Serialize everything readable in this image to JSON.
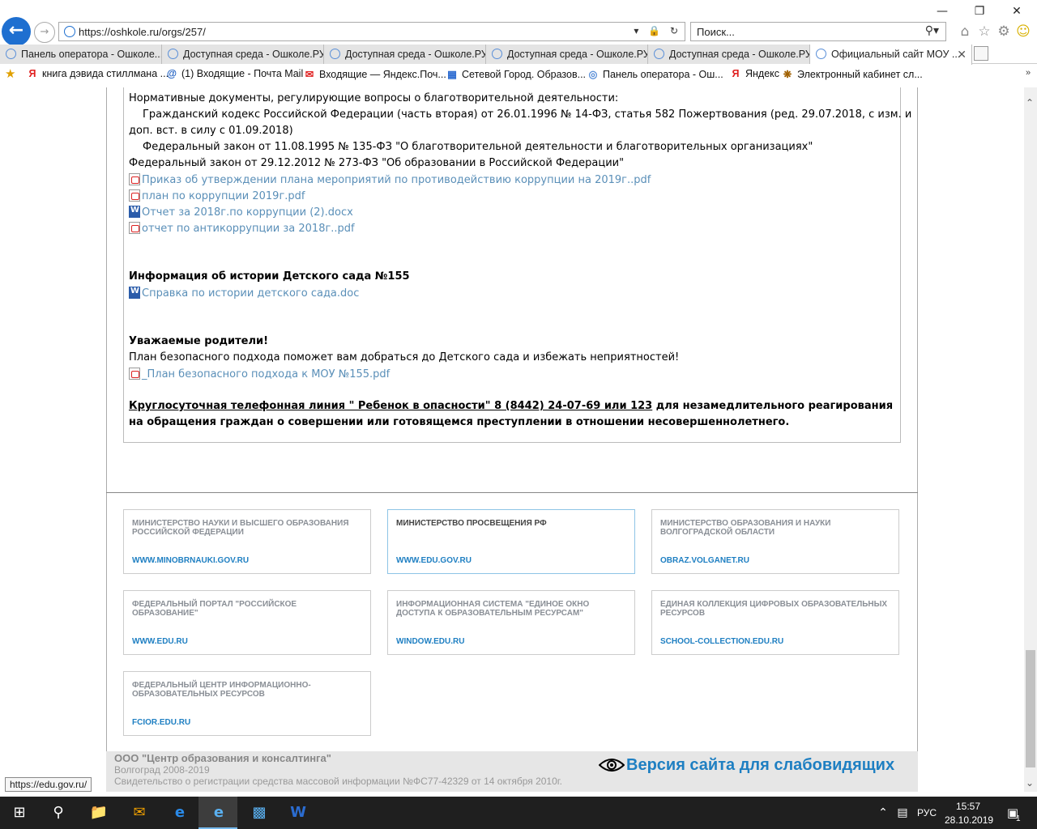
{
  "browser": {
    "url": "https://oshkole.ru/orgs/257/",
    "search_placeholder": "Поиск...",
    "tabs": [
      {
        "label": "Панель оператора - Ошколе...",
        "active": false
      },
      {
        "label": "Доступная среда - Ошколе.РУ",
        "active": false
      },
      {
        "label": "Доступная среда - Ошколе.РУ",
        "active": false
      },
      {
        "label": "Доступная среда - Ошколе.РУ",
        "active": false
      },
      {
        "label": "Доступная среда - Ошколе.РУ",
        "active": false
      },
      {
        "label": "Официальный сайт МОУ ...",
        "active": true
      }
    ],
    "favorites": [
      {
        "icon": "yandex-icon",
        "label": "книга дэвида стиллмана ..."
      },
      {
        "icon": "mail-icon",
        "label": "(1) Входящие - Почта Mail"
      },
      {
        "icon": "yandex-mail-icon",
        "label": "Входящие — Яндекс.Поч..."
      },
      {
        "icon": "school-icon",
        "label": "Сетевой Город. Образов..."
      },
      {
        "icon": "globe-icon",
        "label": "Панель оператора - Ош..."
      },
      {
        "icon": "yandex-icon",
        "label": "Яндекс"
      },
      {
        "icon": "cabinet-icon",
        "label": "Электронный кабинет сл..."
      }
    ]
  },
  "content": {
    "l1": "Нормативные документы, регулирующие вопросы о благотворительной деятельности:",
    "l2": "Гражданский кодекс Российской Федерации (часть вторая) от 26.01.1996 № 14-ФЗ, статья 582 Пожертвования (ред. 29.07.2018, с изм. и",
    "l3": "доп. вст. в силу с 01.09.2018)",
    "l4": "Федеральный закон от 11.08.1995 № 135-ФЗ \"О благотворительной деятельности и благотворительных организациях\"",
    "l5": "Федеральный закон от 29.12.2012 № 273-ФЗ \"Об образовании в Российской Федерации\"",
    "files1": [
      {
        "type": "pdf",
        "label": "Приказ об утверждении плана мероприятий по противодействию коррупции на 2019г..pdf"
      },
      {
        "type": "pdf",
        "label": "план по коррупции 2019г.pdf"
      },
      {
        "type": "doc",
        "label": "Отчет за 2018г.по коррупции (2).docx"
      },
      {
        "type": "pdf",
        "label": "отчет по антикоррупции за 2018г..pdf"
      }
    ],
    "history_heading": "Информация об истории Детского сада №155",
    "history_file": "Справка по истории детского сада.doc",
    "parents_heading": "Уважаемые родители!",
    "parents_text": "План безопасного подхода поможет вам добраться до Детского сада и избежать неприятностей!",
    "safety_file": "_План безопасного подхода к МОУ №155.pdf",
    "hotline_underlined": "Круглосуточная телефонная линия \" Ребенок в опасности\" 8 (8442) 24-07-69 или 123",
    "hotline_rest": " для незамедлительного реагирования",
    "hotline_line2": "на обращения граждан о совершении или готовящемся преступлении в отношении несовершеннолетнего."
  },
  "cards": [
    {
      "title": "Министерство науки и высшего образования Российской Федерации",
      "link": "WWW.MINOBRNAUKI.GOV.RU",
      "highlight": false
    },
    {
      "title": "Министерство просвещения РФ",
      "link": "WWW.EDU.GOV.RU",
      "highlight": true
    },
    {
      "title": "Министерство образования и науки Волгоградской области",
      "link": "OBRAZ.VOLGANET.RU",
      "highlight": false
    },
    {
      "title": "Федеральный портал \"Российское образование\"",
      "link": "WWW.EDU.RU",
      "highlight": false
    },
    {
      "title": "Информационная система \"Единое окно доступа к образовательным ресурсам\"",
      "link": "WINDOW.EDU.RU",
      "highlight": false
    },
    {
      "title": "Единая коллекция цифровых образовательных ресурсов",
      "link": "SCHOOL-COLLECTION.EDU.RU",
      "highlight": false
    },
    {
      "title": "Федеральный центр информационно-образовательных ресурсов",
      "link": "FCIOR.EDU.RU",
      "highlight": false
    }
  ],
  "footer": {
    "company": "ООО \"Центр образования и консалтинга\"",
    "city": "Волгоград 2008-2019",
    "license": "Свидетельство о регистрации средства массовой информации №ФС77-42329 от 14 октября 2010г.",
    "vision_link": "Версия сайта для слабовидящих"
  },
  "status_tip": "https://edu.gov.ru/",
  "taskbar": {
    "lang": "РУС",
    "time": "15:57",
    "date": "28.10.2019",
    "notif_count": "1"
  }
}
